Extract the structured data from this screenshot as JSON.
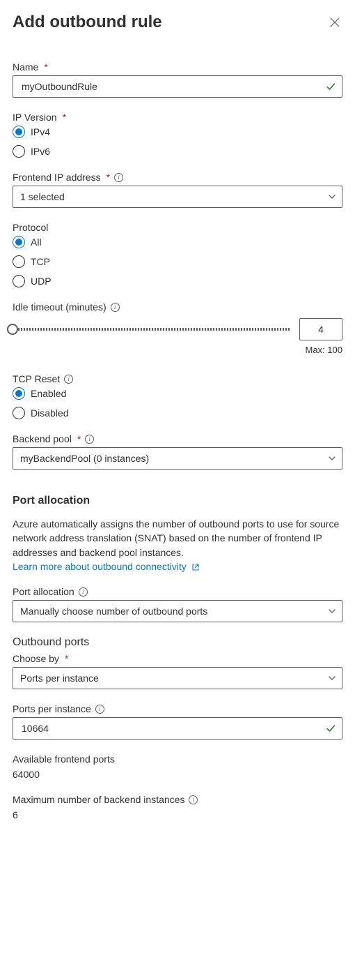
{
  "header": {
    "title": "Add outbound rule"
  },
  "name": {
    "label": "Name",
    "value": "myOutboundRule"
  },
  "ipVersion": {
    "label": "IP Version",
    "options": {
      "ipv4": "IPv4",
      "ipv6": "IPv6"
    }
  },
  "frontendIp": {
    "label": "Frontend IP address",
    "value": "1 selected"
  },
  "protocol": {
    "label": "Protocol",
    "options": {
      "all": "All",
      "tcp": "TCP",
      "udp": "UDP"
    }
  },
  "idleTimeout": {
    "label": "Idle timeout (minutes)",
    "value": "4",
    "maxLabel": "Max: 100"
  },
  "tcpReset": {
    "label": "TCP Reset",
    "options": {
      "enabled": "Enabled",
      "disabled": "Disabled"
    }
  },
  "backendPool": {
    "label": "Backend pool",
    "value": "myBackendPool (0 instances)"
  },
  "portAllocation": {
    "heading": "Port allocation",
    "description": "Azure automatically assigns the number of outbound ports to use for source network address translation (SNAT) based on the number of frontend IP addresses and backend pool instances.",
    "linkText": "Learn more about outbound connectivity",
    "label": "Port allocation",
    "value": "Manually choose number of outbound ports"
  },
  "outboundPorts": {
    "heading": "Outbound ports",
    "chooseBy": {
      "label": "Choose by",
      "value": "Ports per instance"
    },
    "portsPerInstance": {
      "label": "Ports per instance",
      "value": "10664"
    },
    "availablePorts": {
      "label": "Available frontend ports",
      "value": "64000"
    },
    "maxInstances": {
      "label": "Maximum number of backend instances",
      "value": "6"
    }
  }
}
